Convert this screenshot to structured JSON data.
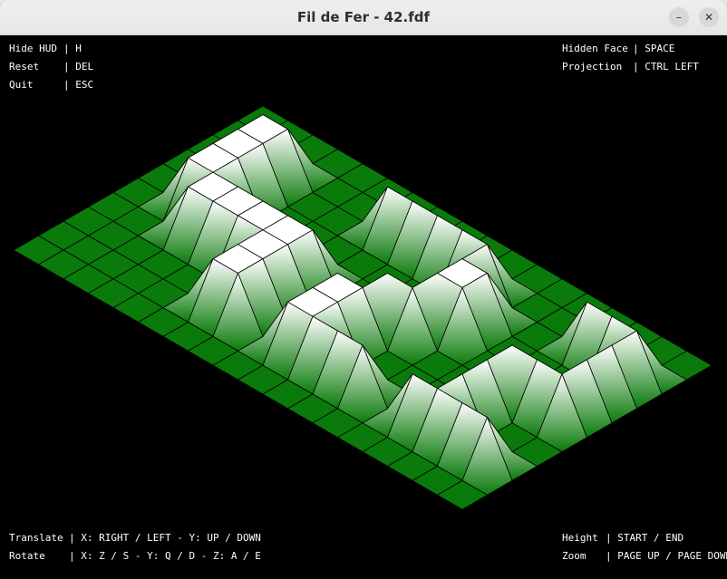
{
  "window": {
    "title": "Fil de Fer - 42.fdf",
    "minimize_glyph": "–",
    "close_glyph": "✕"
  },
  "hud": {
    "top_left": [
      {
        "label": "Hide HUD",
        "key": "H"
      },
      {
        "label": "Reset",
        "key": "DEL"
      },
      {
        "label": "Quit",
        "key": "ESC"
      }
    ],
    "top_right": [
      {
        "label": "Hidden Face",
        "key": "SPACE"
      },
      {
        "label": "Projection",
        "key": "CTRL LEFT"
      }
    ],
    "bottom_left": [
      {
        "label": "Translate",
        "key": "X: RIGHT / LEFT - Y: UP / DOWN"
      },
      {
        "label": "Rotate",
        "key": "X: Z / S - Y: Q / D - Z: A / E"
      }
    ],
    "bottom_right": [
      {
        "label": "Height",
        "key": "START / END"
      },
      {
        "label": "Zoom",
        "key": "PAGE UP / PAGE DOWN"
      }
    ]
  },
  "map": {
    "rows": 11,
    "cols": 19,
    "heights": [
      [
        0,
        0,
        0,
        0,
        0,
        0,
        0,
        0,
        0,
        0,
        0,
        0,
        0,
        0,
        0,
        0,
        0,
        0,
        0
      ],
      [
        0,
        0,
        0,
        0,
        0,
        0,
        0,
        0,
        0,
        0,
        0,
        0,
        0,
        0,
        0,
        0,
        0,
        0,
        0
      ],
      [
        0,
        0,
        10,
        10,
        0,
        0,
        0,
        10,
        10,
        10,
        10,
        10,
        0,
        0,
        0,
        10,
        10,
        10,
        0
      ],
      [
        0,
        0,
        10,
        10,
        0,
        0,
        0,
        0,
        0,
        0,
        0,
        10,
        10,
        0,
        0,
        0,
        0,
        10,
        0
      ],
      [
        0,
        0,
        10,
        10,
        0,
        0,
        0,
        0,
        0,
        0,
        0,
        10,
        10,
        0,
        0,
        0,
        0,
        10,
        0
      ],
      [
        0,
        0,
        10,
        10,
        10,
        10,
        10,
        10,
        0,
        0,
        10,
        10,
        0,
        0,
        0,
        10,
        10,
        10,
        0
      ],
      [
        0,
        0,
        0,
        10,
        10,
        10,
        10,
        10,
        0,
        10,
        10,
        0,
        0,
        0,
        0,
        10,
        0,
        0,
        0
      ],
      [
        0,
        0,
        0,
        0,
        0,
        0,
        10,
        10,
        0,
        10,
        10,
        0,
        0,
        0,
        0,
        10,
        0,
        0,
        0
      ],
      [
        0,
        0,
        0,
        0,
        0,
        0,
        10,
        10,
        0,
        10,
        10,
        10,
        10,
        0,
        10,
        10,
        10,
        10,
        0
      ],
      [
        0,
        0,
        0,
        0,
        0,
        0,
        0,
        0,
        0,
        0,
        0,
        0,
        0,
        0,
        0,
        0,
        0,
        0,
        0
      ],
      [
        0,
        0,
        0,
        0,
        0,
        0,
        0,
        0,
        0,
        0,
        0,
        0,
        0,
        0,
        0,
        0,
        0,
        0,
        0
      ]
    ],
    "base_color": "#0a7a0a",
    "peak_color": "#ffffff",
    "line_color": "#000000"
  }
}
